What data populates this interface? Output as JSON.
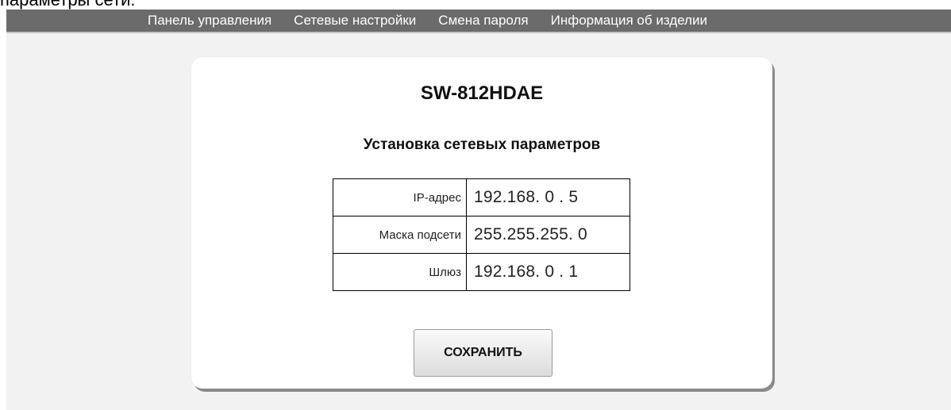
{
  "top_cut_text": "параметры сети.",
  "nav": {
    "items": [
      {
        "label": "Панель управления"
      },
      {
        "label": "Сетевые настройки"
      },
      {
        "label": "Смена пароля"
      },
      {
        "label": "Информация об изделии"
      }
    ]
  },
  "panel": {
    "device_title": "SW-812HDAE",
    "section_title": "Установка сетевых параметров",
    "rows": [
      {
        "label": "IP-адрес",
        "value": "192.168. 0 . 5"
      },
      {
        "label": "Маска подсети",
        "value": "255.255.255. 0"
      },
      {
        "label": "Шлюз",
        "value": "192.168. 0 . 1"
      }
    ],
    "save_label": "СОХРАНИТЬ"
  },
  "colors": {
    "nav_background": "#6b6b6b",
    "page_background": "#f2f2f2",
    "panel_background": "#ffffff",
    "panel_shadow": "#8a8a8a"
  }
}
